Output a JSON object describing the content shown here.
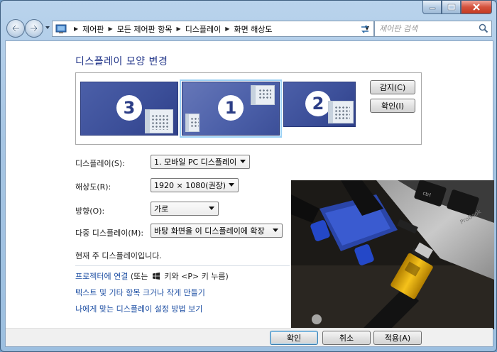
{
  "window": {
    "controls": {
      "minimize": "minimize",
      "maximize": "maximize",
      "close": "close"
    }
  },
  "nav": {
    "breadcrumbs": [
      "제어판",
      "모든 제어판 항목",
      "디스플레이",
      "화면 해상도"
    ],
    "search_placeholder": "제어판 검색"
  },
  "page": {
    "title": "디스플레이 모양 변경",
    "monitors": [
      {
        "number": "3",
        "selected": false
      },
      {
        "number": "1",
        "selected": true
      },
      {
        "number": "2",
        "selected": false
      }
    ],
    "detect_button": "감지(C)",
    "identify_button": "확인(I)"
  },
  "settings": {
    "display_label": "디스플레이(S):",
    "display_value": "1. 모바일 PC 디스플레이",
    "resolution_label": "해상도(R):",
    "resolution_value": "1920 × 1080(권장)",
    "orientation_label": "방향(O):",
    "orientation_value": "가로",
    "multi_label": "다중 디스플레이(M):",
    "multi_value": "바탕 화면을 이 디스플레이에 확장",
    "current_note": "현재 주 디스플레이입니다."
  },
  "links": {
    "projector_link": "프로젝터에 연결",
    "projector_hint_pre": "(또는",
    "projector_hint_post": "키와 <P> 키 누름)",
    "text_size_link": "텍스트 및 기타 항목 크거나 작게 만들기",
    "help_link": "나에게 맞는 디스플레이 설정 방법 보기"
  },
  "footer": {
    "ok": "확인",
    "cancel": "취소",
    "apply": "적용(A)"
  },
  "colors": {
    "title_blue": "#1e3287",
    "link_blue": "#1e4fa3",
    "monitor_blue": "#3b4e98"
  }
}
